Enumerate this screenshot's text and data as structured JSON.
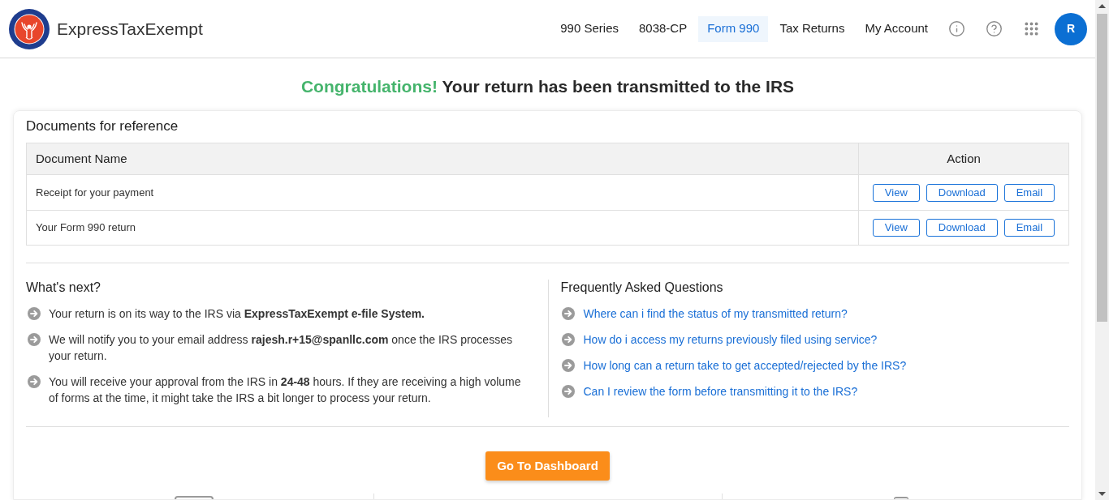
{
  "header": {
    "brand": "ExpressTaxExempt",
    "nav": [
      {
        "label": "990 Series",
        "selected": false
      },
      {
        "label": "8038-CP",
        "selected": false
      },
      {
        "label": "Form 990",
        "selected": true
      },
      {
        "label": "Tax Returns",
        "selected": false
      },
      {
        "label": "My Account",
        "selected": false
      }
    ],
    "avatar": "R"
  },
  "banner": {
    "highlight": "Congratulations!",
    "text": "Your return has been transmitted to the IRS"
  },
  "documents": {
    "title": "Documents for reference",
    "columns": [
      "Document Name",
      "Action"
    ],
    "rows": [
      {
        "name": "Receipt for your payment",
        "actions": [
          "View",
          "Download",
          "Email"
        ]
      },
      {
        "name": "Your Form 990 return",
        "actions": [
          "View",
          "Download",
          "Email"
        ]
      }
    ]
  },
  "whats_next": {
    "title": "What's next?",
    "items": [
      "Your return is on its way to the IRS via **ExpressTaxExempt e-file System.**",
      "We will notify you to your email address **rajesh.r+15@spanllc.com** once the IRS processes your return.",
      "You will receive your approval from the IRS in **24-48** hours. If they are receiving a high volume of forms at the time, it might take the IRS a bit longer to process your return."
    ]
  },
  "faq": {
    "title": "Frequently Asked Questions",
    "items": [
      "Where can i find the status of my transmitted return?",
      "How do i access my returns previously filed using service?",
      "How long can a return take to get accepted/rejected by the IRS?",
      "Can I review the form before transmitting it to the IRS?"
    ]
  },
  "dashboard_button": "Go To Dashboard"
}
